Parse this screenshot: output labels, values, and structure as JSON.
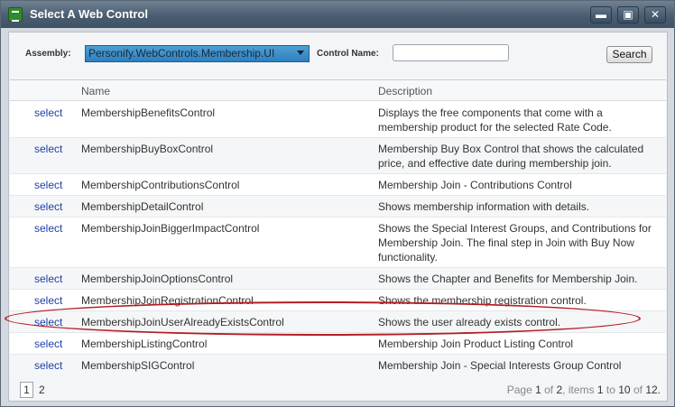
{
  "window": {
    "title": "Select A Web Control",
    "minimize_label": "▬",
    "maximize_label": "▣",
    "close_label": "✕"
  },
  "filters": {
    "assembly_label": "Assembly:",
    "assembly_value": "Personify.WebControls.Membership.UI",
    "control_name_label": "Control Name:",
    "control_name_value": "",
    "search_label": "Search"
  },
  "grid": {
    "columns": [
      "",
      "Name",
      "Description"
    ],
    "rows": [
      {
        "action": "select",
        "name": "MembershipBenefitsControl",
        "description": "Displays the free components that come with a membership product for the selected Rate Code."
      },
      {
        "action": "select",
        "name": "MembershipBuyBoxControl",
        "description": "Membership Buy Box Control that shows the calculated price, and effective date during membership join."
      },
      {
        "action": "select",
        "name": "MembershipContributionsControl",
        "description": "Membership Join - Contributions Control"
      },
      {
        "action": "select",
        "name": "MembershipDetailControl",
        "description": "Shows membership information with details."
      },
      {
        "action": "select",
        "name": "MembershipJoinBiggerImpactControl",
        "description": "Shows the Special Interest Groups, and Contributions for Membership Join. The final step in Join with Buy Now functionality."
      },
      {
        "action": "select",
        "name": "MembershipJoinOptionsControl",
        "description": "Shows the Chapter and Benefits for Membership Join."
      },
      {
        "action": "select",
        "name": "MembershipJoinRegistrationControl",
        "description": "Shows the membership registration control."
      },
      {
        "action": "select",
        "name": "MembershipJoinUserAlreadyExistsControl",
        "description": "Shows the user already exists control."
      },
      {
        "action": "select",
        "name": "MembershipListingControl",
        "description": "Membership Join Product Listing Control"
      },
      {
        "action": "select",
        "name": "MembershipSIGControl",
        "description": "Membership Join - Special Interests Group Control"
      }
    ]
  },
  "pager": {
    "current_page": "1",
    "other_page": "2",
    "info": {
      "page_word": "Page",
      "page": "1",
      "of_word": "of",
      "pages": "2",
      "items_word": ", items",
      "from": "1",
      "to_word": "to",
      "to": "10",
      "of2_word": "of",
      "total": "12."
    }
  },
  "colors": {
    "titlebar": "#4b5d70",
    "select_link": "#1f3fa8",
    "highlight_ring": "#b31e23",
    "assembly_select": "#2e80bd"
  }
}
